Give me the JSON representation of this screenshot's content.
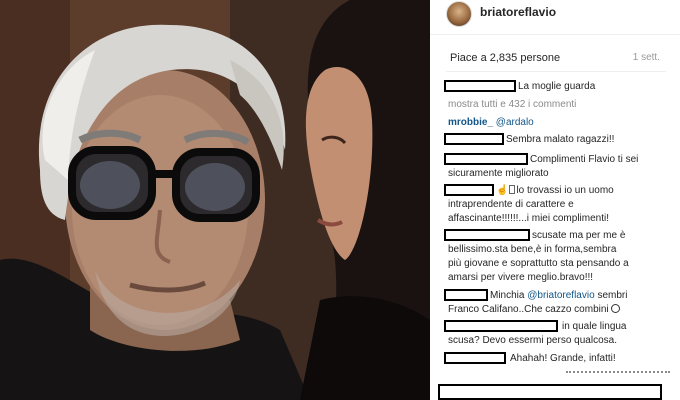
{
  "post": {
    "username": "briatoreflavio",
    "likes_text": "Piace a 2,835 persone",
    "time_ago": "1 sett."
  },
  "caption": {
    "text": "La moglie guarda",
    "view_all": "mostra tutti e 432 i commenti"
  },
  "comments": [
    {
      "author": "mrobbie_",
      "mention": "@ardalo"
    },
    {
      "text": "Sembra malato ragazzi!!"
    },
    {
      "line1": "Complimenti Flavio ti sei",
      "line2": "sicuramente migliorato"
    },
    {
      "line1": "lo trovassi io un uomo",
      "line2": "intraprendente di carattere e",
      "line3": "affascinante!!!!!!...i miei complimenti!"
    },
    {
      "line1": "scusate ma per me è",
      "line2": "bellissimo.sta bene,è in forma,sembra",
      "line3": "più giovane e soprattutto sta pensando a",
      "line4": "amarsi per vivere meglio.bravo!!!"
    },
    {
      "prefix": "Minchia",
      "mention": "@briatoreflavio",
      "suffix": "sembri",
      "line2": "Franco Califano..Che cazzo combini"
    },
    {
      "line1": "in quale lingua",
      "line2": "scusa? Devo essermi perso qualcosa."
    },
    {
      "text": "Ahahah! Grande, infatti!"
    }
  ],
  "icons": {
    "avatar": "profile-avatar",
    "hand": "pointing-hand-emoji",
    "box": "missing-glyph-box",
    "sad": "sad-face-emoji"
  },
  "colors": {
    "link": "#125688",
    "muted": "#8a8a8a",
    "text": "#262626",
    "redaction": "#000000"
  }
}
